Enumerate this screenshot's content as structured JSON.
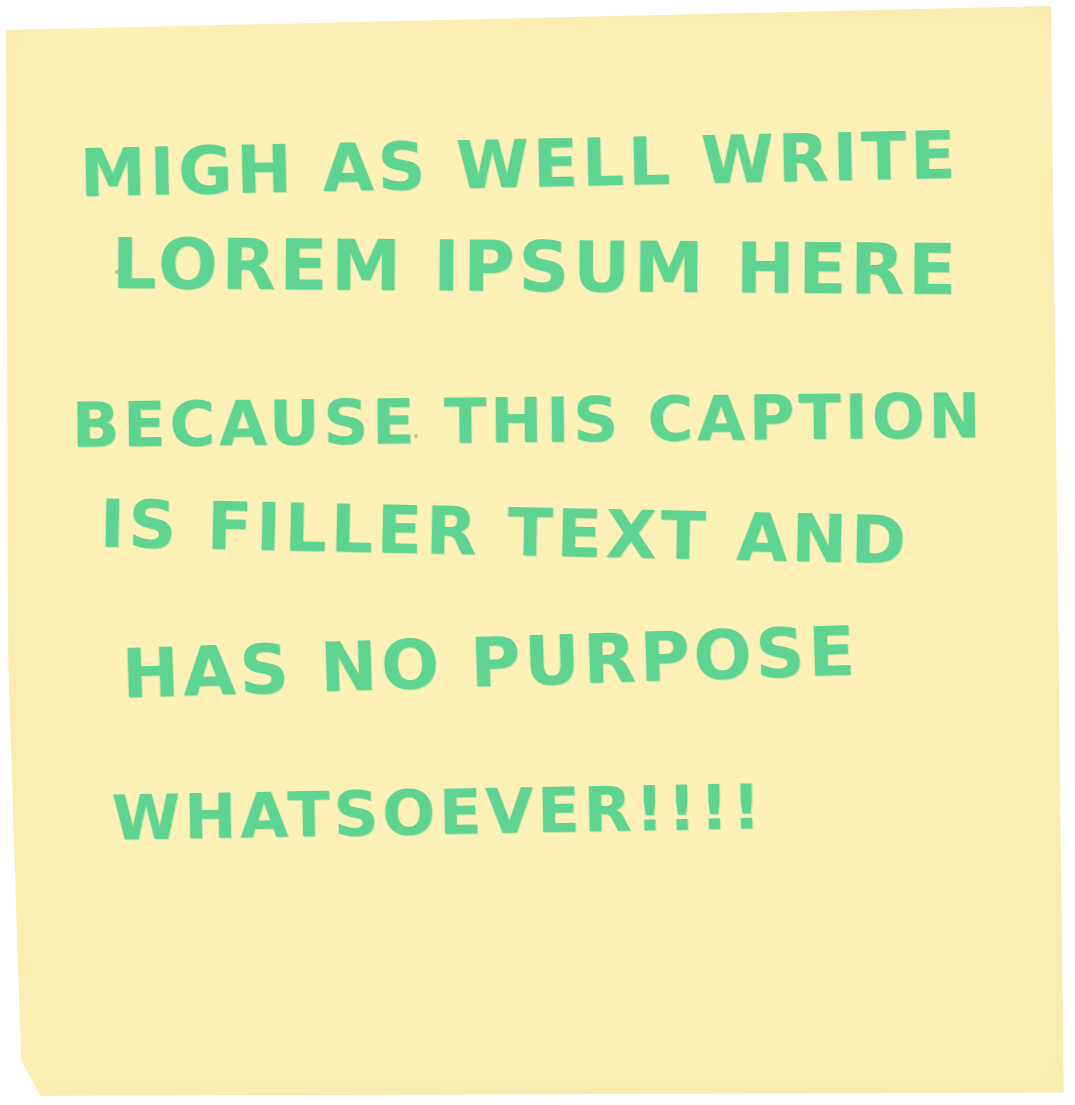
{
  "note": {
    "paper_color": "#fdf1b7",
    "ink_color": "#4fd08d",
    "lines": [
      "MIGH AS WELL WRITE",
      "LOREM IPSUM HERE",
      "BECAUSE THIS CAPTION",
      "IS FILLER TEXT AND",
      "HAS NO PURPOSE",
      "WHATSOEVER!!!!"
    ]
  }
}
